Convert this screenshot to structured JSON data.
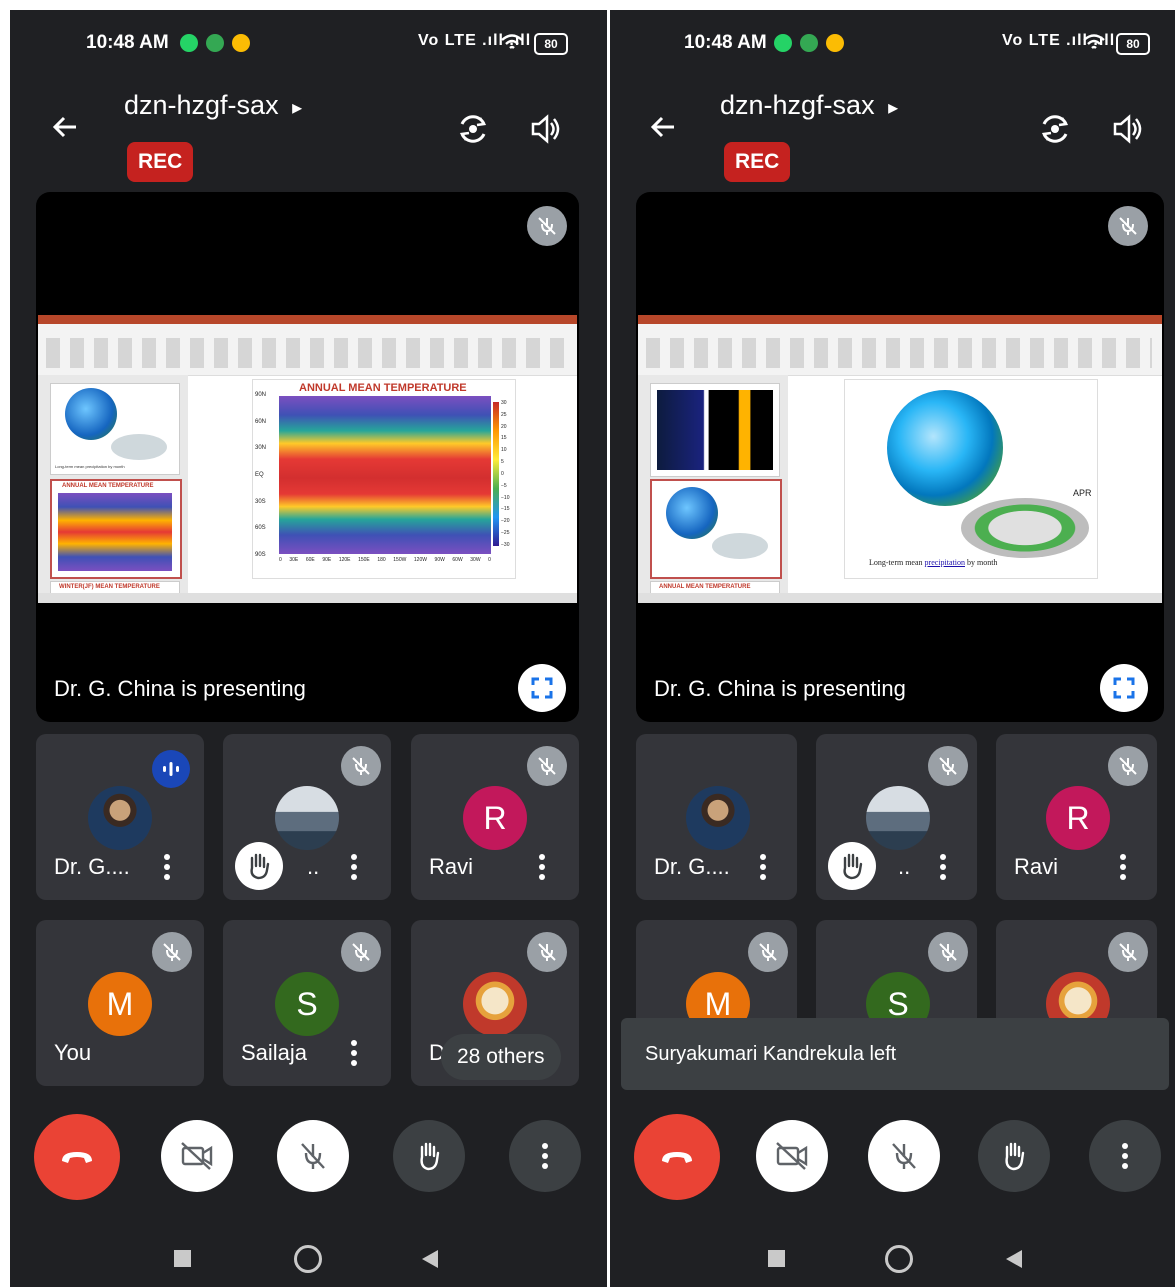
{
  "status": {
    "time": "10:48 AM",
    "signal_text": "Vo LTE .ıll .ıll",
    "battery": "80"
  },
  "meeting": {
    "title": "dzn-hzgf-sax",
    "title_arrow": "▸",
    "rec_label": "REC",
    "presenter_caption": "Dr. G. China is presenting"
  },
  "slide_left": {
    "title": "ANNUAL MEAN TEMPERATURE",
    "lat_labels": [
      "90N",
      "60N",
      "30N",
      "EQ",
      "30S",
      "60S",
      "90S"
    ],
    "lon_labels": [
      "0",
      "30E",
      "60E",
      "90E",
      "120E",
      "150E",
      "180",
      "150W",
      "120W",
      "90W",
      "60W",
      "30W",
      "0"
    ],
    "legend_labels": [
      "30",
      "25",
      "20",
      "15",
      "10",
      "5",
      "0",
      "−5",
      "−10",
      "−15",
      "−20",
      "−25",
      "−30"
    ],
    "thumb1_caption": "Long-term mean precipitation by month",
    "thumb2_title": "ANNUAL MEAN TEMPERATURE",
    "thumb3_title": "WINTER(JF) MEAN TEMPERATURE"
  },
  "slide_right": {
    "month": "APR",
    "caption_prefix": "Long-term mean",
    "caption_link": "precipitation",
    "caption_suffix": "by month",
    "thumb3_title": "ANNUAL MEAN TEMPERATURE"
  },
  "participants_left": [
    {
      "name": "Dr. G....",
      "type": "photo"
    },
    {
      "name": "..",
      "type": "photo"
    },
    {
      "name": "Ravi",
      "initial": "R",
      "color": "#c2185b"
    },
    {
      "name": "You",
      "initial": "M",
      "color": "#e8710a"
    },
    {
      "name": "Sailaja",
      "initial": "S",
      "color": "#33691e"
    },
    {
      "name": "Dr",
      "type": "photo"
    }
  ],
  "others_label": "28 others",
  "toast_text": "Suryakumari Kandrekula left",
  "colors": {
    "background": "#1f2023",
    "tile": "#34353a",
    "end_call": "#ea4335",
    "rec": "#c5221f",
    "speaking": "#1a47b8"
  }
}
